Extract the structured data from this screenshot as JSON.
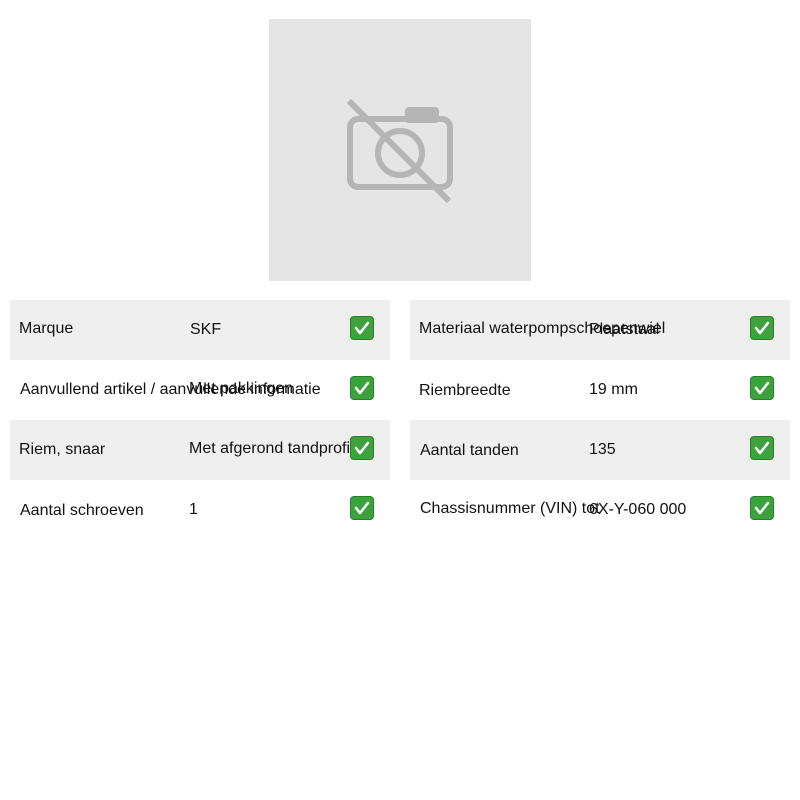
{
  "image": {
    "icon": "camera-off-icon",
    "background_color": "#e5e5e5"
  },
  "specs_left": [
    {
      "label": "Marque",
      "value": "SKF",
      "status_icon": "check-icon"
    },
    {
      "label": "Aanvullend artikel / aanvullende informatie",
      "value": "Met pakkingen",
      "status_icon": "check-icon"
    },
    {
      "label": "Riem, snaar",
      "value": "Met afgerond tandprofiel",
      "status_icon": "check-icon"
    },
    {
      "label": "Aantal schroeven",
      "value": "1",
      "status_icon": "check-icon"
    }
  ],
  "specs_right": [
    {
      "label": "Materiaal waterpompschoepenwiel",
      "value": "Plaatstaal",
      "status_icon": "check-icon"
    },
    {
      "label": "Riembreedte",
      "value": "19 mm",
      "status_icon": "check-icon"
    },
    {
      "label": "Aantal tanden",
      "value": "135",
      "status_icon": "check-icon"
    },
    {
      "label": "Chassisnummer (VIN) tot",
      "value": "6X-Y-060 000",
      "status_icon": "check-icon"
    }
  ],
  "colors": {
    "row_shade": "#efefef",
    "check_green": "#3ca33c"
  }
}
